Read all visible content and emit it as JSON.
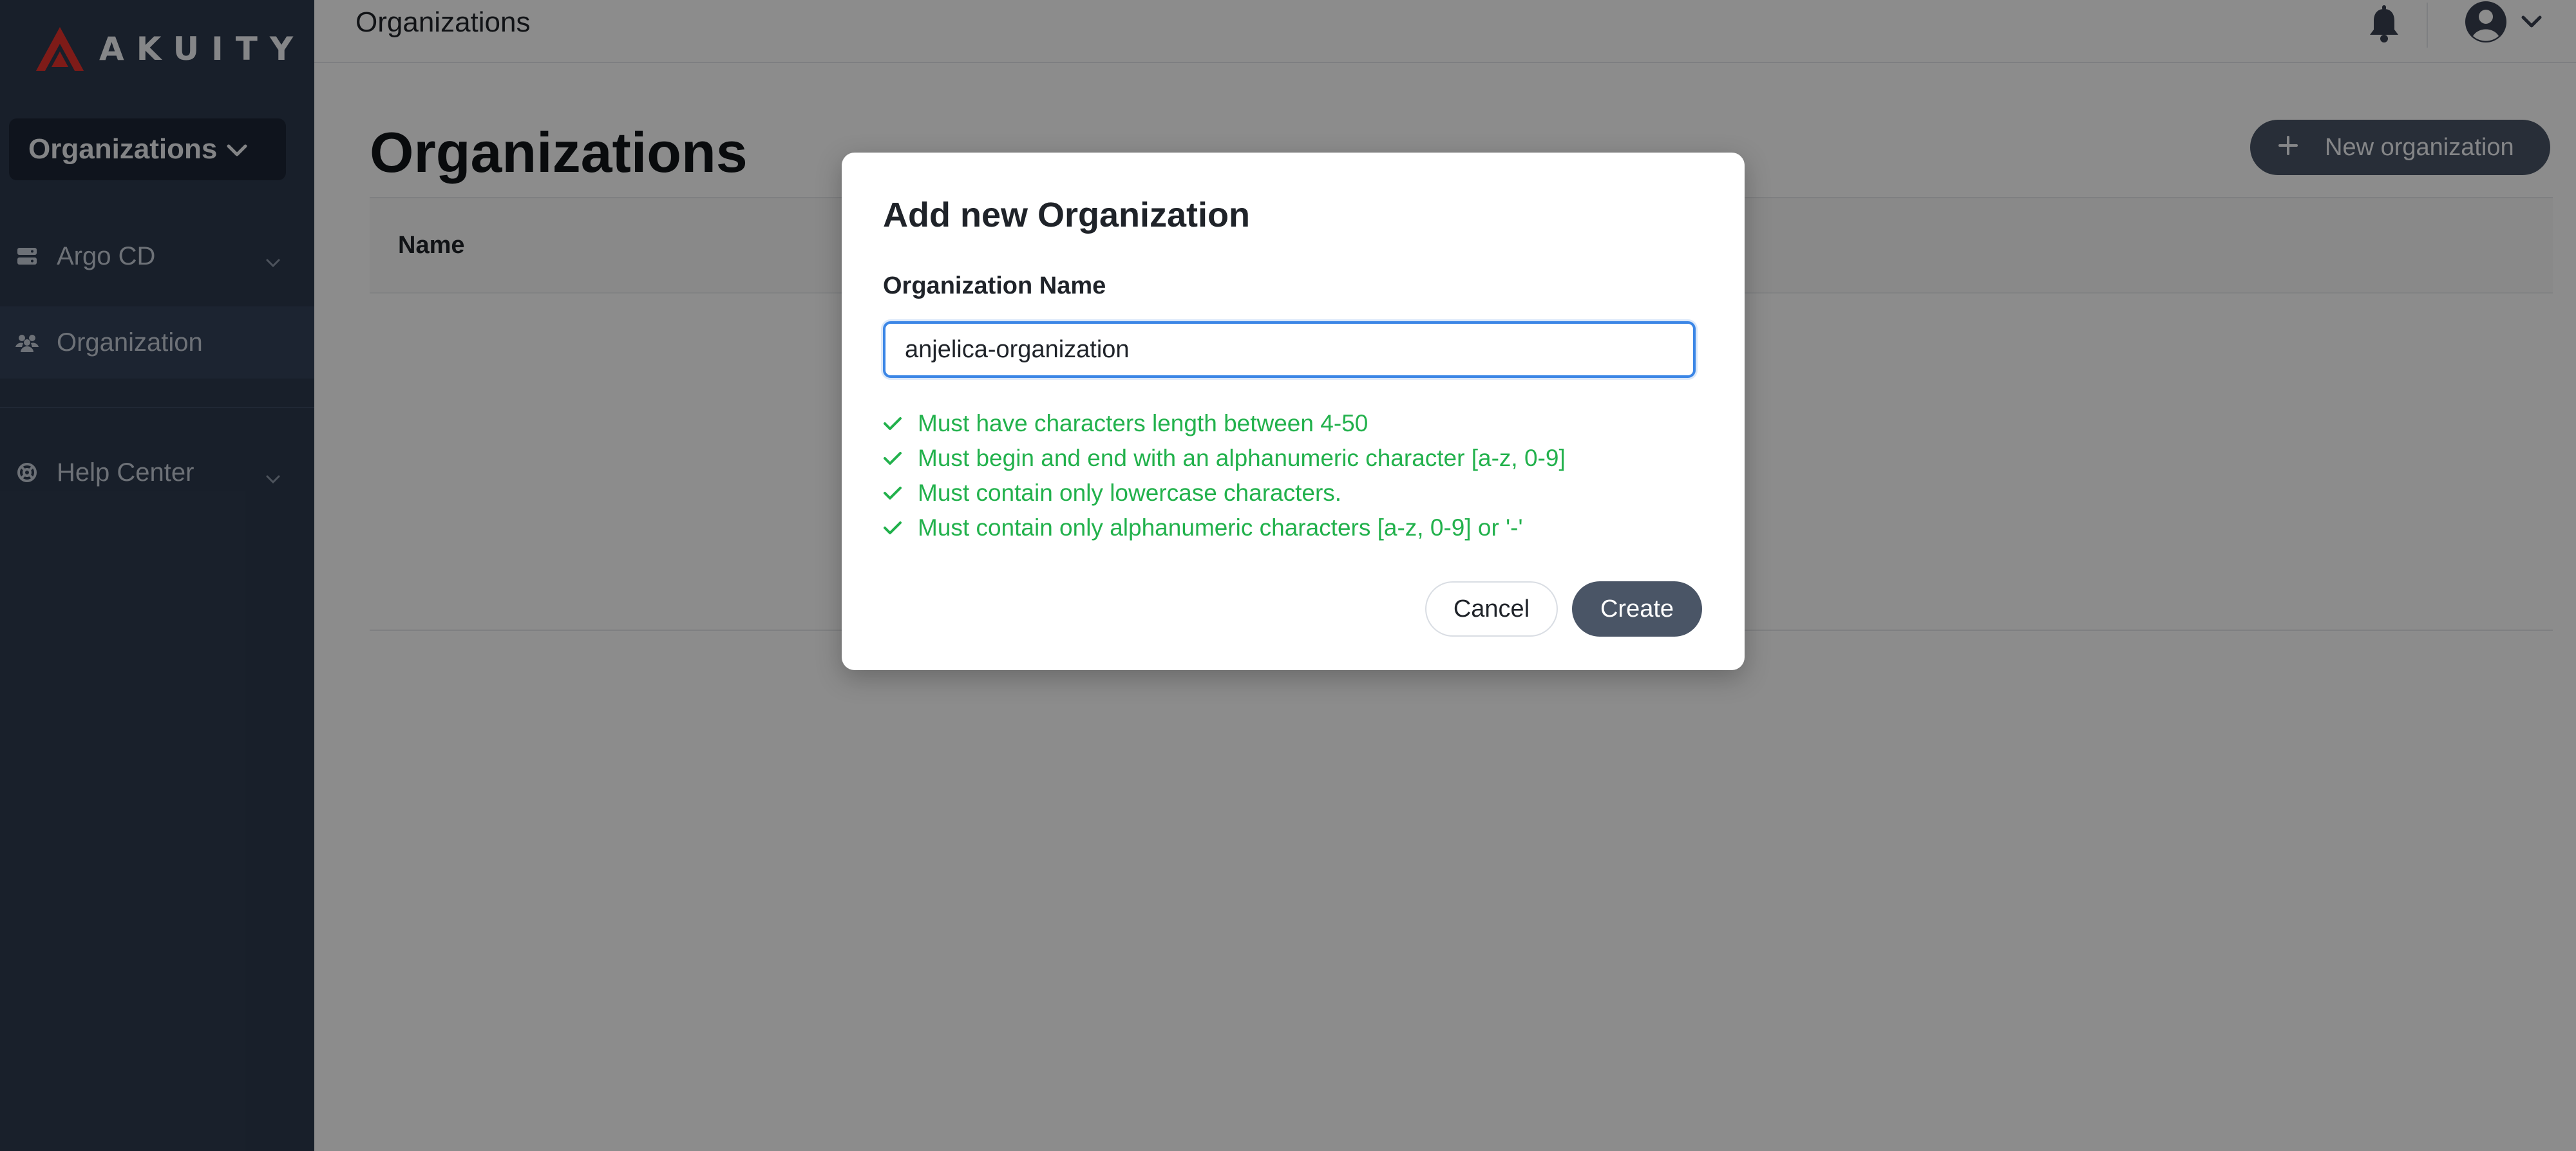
{
  "brand": {
    "name": "AKUITY",
    "accent": "#e5322d"
  },
  "sidebar": {
    "org_switcher": "Organizations",
    "items": [
      {
        "label": "Argo CD",
        "icon": "server-icon",
        "active": false
      },
      {
        "label": "Organization",
        "icon": "users-icon",
        "active": true
      },
      {
        "label": "Help Center",
        "icon": "lifebuoy-icon",
        "active": false
      }
    ]
  },
  "topbar": {
    "title": "Organizations"
  },
  "page": {
    "title": "Organizations",
    "new_button": "New organization",
    "table_header_name": "Name"
  },
  "modal": {
    "title": "Add new Organization",
    "field_label": "Organization Name",
    "input_value": "anjelica-organization",
    "rules": [
      "Must have characters length between 4-50",
      "Must begin and end with an alphanumeric character [a-z, 0-9]",
      "Must contain only lowercase characters.",
      "Must contain only alphanumeric characters [a-z, 0-9] or '-'"
    ],
    "rule_color": "#22b14c",
    "cancel_label": "Cancel",
    "create_label": "Create"
  }
}
